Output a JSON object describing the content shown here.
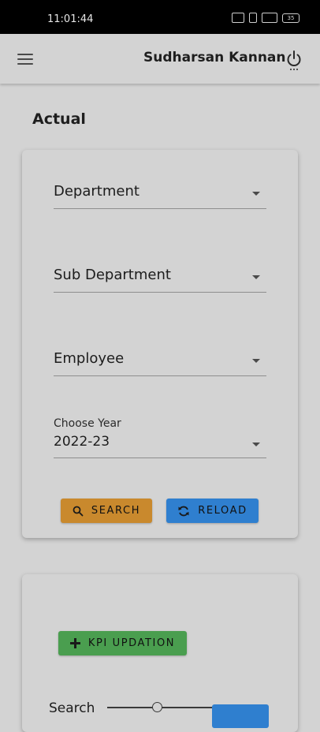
{
  "status_bar": {
    "time": "11:01:44",
    "battery": "35"
  },
  "app_bar": {
    "menu_icon": "hamburger-menu-icon",
    "user_name": "Sudharsan Kannan",
    "power_icon": "power-icon"
  },
  "page": {
    "title": "Actual"
  },
  "filter_card": {
    "department": {
      "value": "Department"
    },
    "sub_department": {
      "value": "Sub Department"
    },
    "employee": {
      "value": "Employee"
    },
    "year": {
      "label": "Choose Year",
      "value": "2022-23"
    },
    "search_button": {
      "label": "SEARCH",
      "icon": "search-icon",
      "color": "#c9892d"
    },
    "reload_button": {
      "label": "RELOAD",
      "icon": "reload-icon",
      "color": "#2f7fcf"
    }
  },
  "results_card": {
    "kpi_button": {
      "label": "KPI UPDATION",
      "icon": "plus-icon",
      "color": "#4a9e4f"
    },
    "search_label": "Search"
  }
}
